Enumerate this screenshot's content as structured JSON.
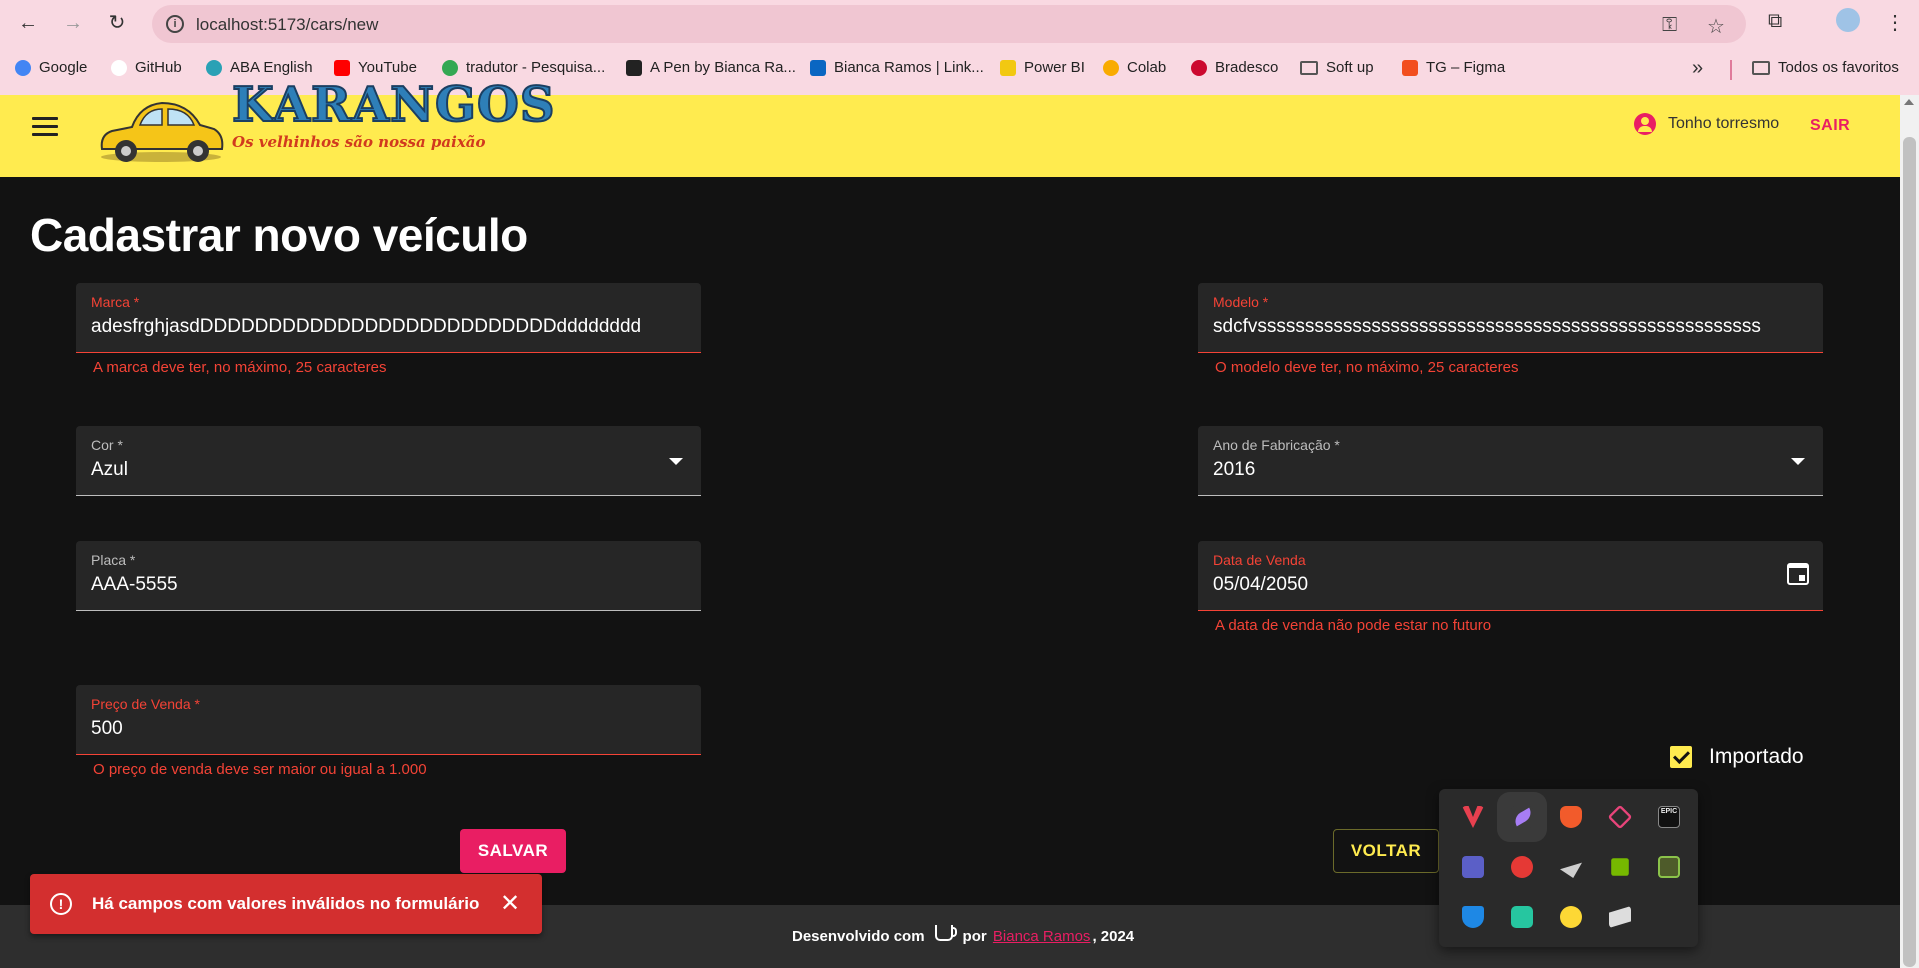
{
  "browser": {
    "url": "localhost:5173/cars/new",
    "bookmarks": [
      {
        "label": "Google",
        "color": "#4285f4"
      },
      {
        "label": "GitHub",
        "color": "#ffffff"
      },
      {
        "label": "ABA English",
        "color": "#2aa1b5"
      },
      {
        "label": "YouTube",
        "color": "#ff0000"
      },
      {
        "label": "tradutor - Pesquisa...",
        "color": "#4285f4"
      },
      {
        "label": "A Pen by Bianca Ra...",
        "color": "#222222"
      },
      {
        "label": "Bianca Ramos | Link...",
        "color": "#0a66c2"
      },
      {
        "label": "Power BI",
        "color": "#f2c811"
      },
      {
        "label": "Colab",
        "color": "#f9ab00"
      },
      {
        "label": "Bradesco",
        "color": "#cc092f"
      },
      {
        "label": "Soft up",
        "color": "#555555"
      },
      {
        "label": "TG – Figma",
        "color": "#f24e1e"
      }
    ],
    "all_bookmarks": "Todos os favoritos"
  },
  "header": {
    "logo_text": "KARANGOS",
    "tagline": "Os velhinhos são nossa paixão",
    "user_name": "Tonho torresmo",
    "logout_label": "SAIR"
  },
  "form": {
    "title": "Cadastrar novo veículo",
    "marca": {
      "label": "Marca *",
      "value": "adesfrghjasdDDDDDDDDDDDDDDDDDDDDDDDDDDdddddddd",
      "error": "A marca deve ter, no máximo, 25 caracteres"
    },
    "modelo": {
      "label": "Modelo *",
      "value": "sdcfvsssssssssssssssssssssssssssssssssssssssssssssssssssss",
      "error": "O modelo deve ter, no máximo, 25 caracteres"
    },
    "cor": {
      "label": "Cor *",
      "value": "Azul"
    },
    "ano": {
      "label": "Ano de Fabricação *",
      "value": "2016"
    },
    "placa": {
      "label": "Placa *",
      "value": "AAA-5555"
    },
    "data_venda": {
      "label": "Data de Venda",
      "value": "05/04/2050",
      "error": "A data de venda não pode estar no futuro"
    },
    "preco": {
      "label": "Preço de Venda *",
      "value": "500",
      "error": "O preço de venda deve ser maior ou igual a 1.000"
    },
    "importado": {
      "label": "Importado",
      "checked": true
    },
    "save_label": "SALVAR",
    "back_label": "VOLTAR"
  },
  "footer": {
    "prefix": "Desenvolvido com",
    "by": "por",
    "author": "Bianca Ramos",
    "year_suffix": ", 2024"
  },
  "snackbar": {
    "message": "Há campos com valores inválidos no formulário"
  },
  "tray_icons": [
    {
      "name": "valorant-tray-icon",
      "color": "#e8404f"
    },
    {
      "name": "feather-tray-icon",
      "color": "#a77df5"
    },
    {
      "name": "brave-tray-icon",
      "color": "#f25b2b"
    },
    {
      "name": "app-tray-icon",
      "color": "#e8447a"
    },
    {
      "name": "epic-games-tray-icon",
      "color": "#e0e0e0"
    },
    {
      "name": "teams-tray-icon",
      "color": "#5b5fc7"
    },
    {
      "name": "recorder-tray-icon",
      "color": "#e53935"
    },
    {
      "name": "plane-tray-icon",
      "color": "#cfcfcf"
    },
    {
      "name": "nvidia-tray-icon",
      "color": "#76b900"
    },
    {
      "name": "hardware-tray-icon",
      "color": "#8bc34a"
    },
    {
      "name": "defender-warning-tray-icon",
      "color": "#1e88e5"
    },
    {
      "name": "wallet-tray-icon",
      "color": "#26c6a0"
    },
    {
      "name": "norton-tray-icon",
      "color": "#fdd835"
    },
    {
      "name": "gaming-tray-icon",
      "color": "#dddddd"
    }
  ],
  "colors": {
    "accent": "#e91e63",
    "header_bg": "#ffeb4f",
    "error": "#f44336"
  }
}
